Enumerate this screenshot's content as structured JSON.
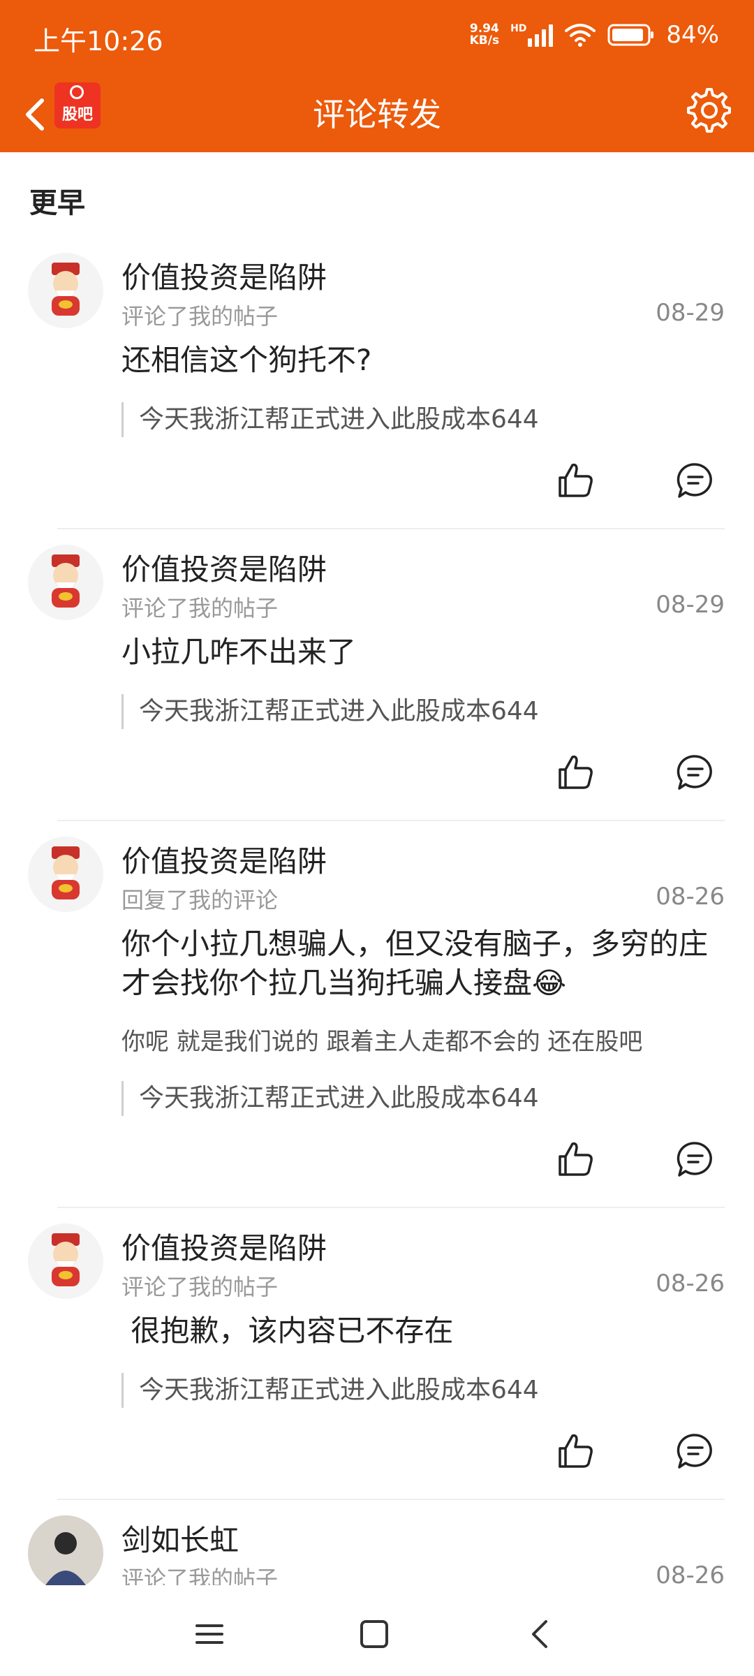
{
  "status_bar": {
    "time": "上午10:26",
    "net_speed_value": "9.94",
    "net_speed_unit": "KB/s",
    "net_type": "HD",
    "battery": "84%"
  },
  "header": {
    "logo_text": "股吧",
    "title": "评论转发"
  },
  "section_label": "更早",
  "items": [
    {
      "username": "价值投资是陷阱",
      "action": "评论了我的帖子",
      "date": "08-29",
      "content": "还相信这个狗托不?",
      "quote": "今天我浙江帮正式进入此股成本644"
    },
    {
      "username": "价值投资是陷阱",
      "action": "评论了我的帖子",
      "date": "08-29",
      "content": "小拉几咋不出来了",
      "quote": "今天我浙江帮正式进入此股成本644"
    },
    {
      "username": "价值投资是陷阱",
      "action": "回复了我的评论",
      "date": "08-26",
      "content": "你个小拉几想骗人，但又没有脑子，多穷的庄才会找你个拉几当狗托骗人接盘😂",
      "reply": "你呢  就是我们说的 跟着主人走都不会的  还在股吧",
      "quote": "今天我浙江帮正式进入此股成本644"
    },
    {
      "username": "价值投资是陷阱",
      "action": "评论了我的帖子",
      "date": "08-26",
      "content": " 很抱歉，该内容已不存在",
      "quote": "今天我浙江帮正式进入此股成本644"
    },
    {
      "username": "剑如长虹",
      "action": "评论了我的帖子",
      "date": "08-26"
    }
  ],
  "colors": {
    "brand": "#ec5a0b",
    "logo_red": "#ee3322"
  }
}
